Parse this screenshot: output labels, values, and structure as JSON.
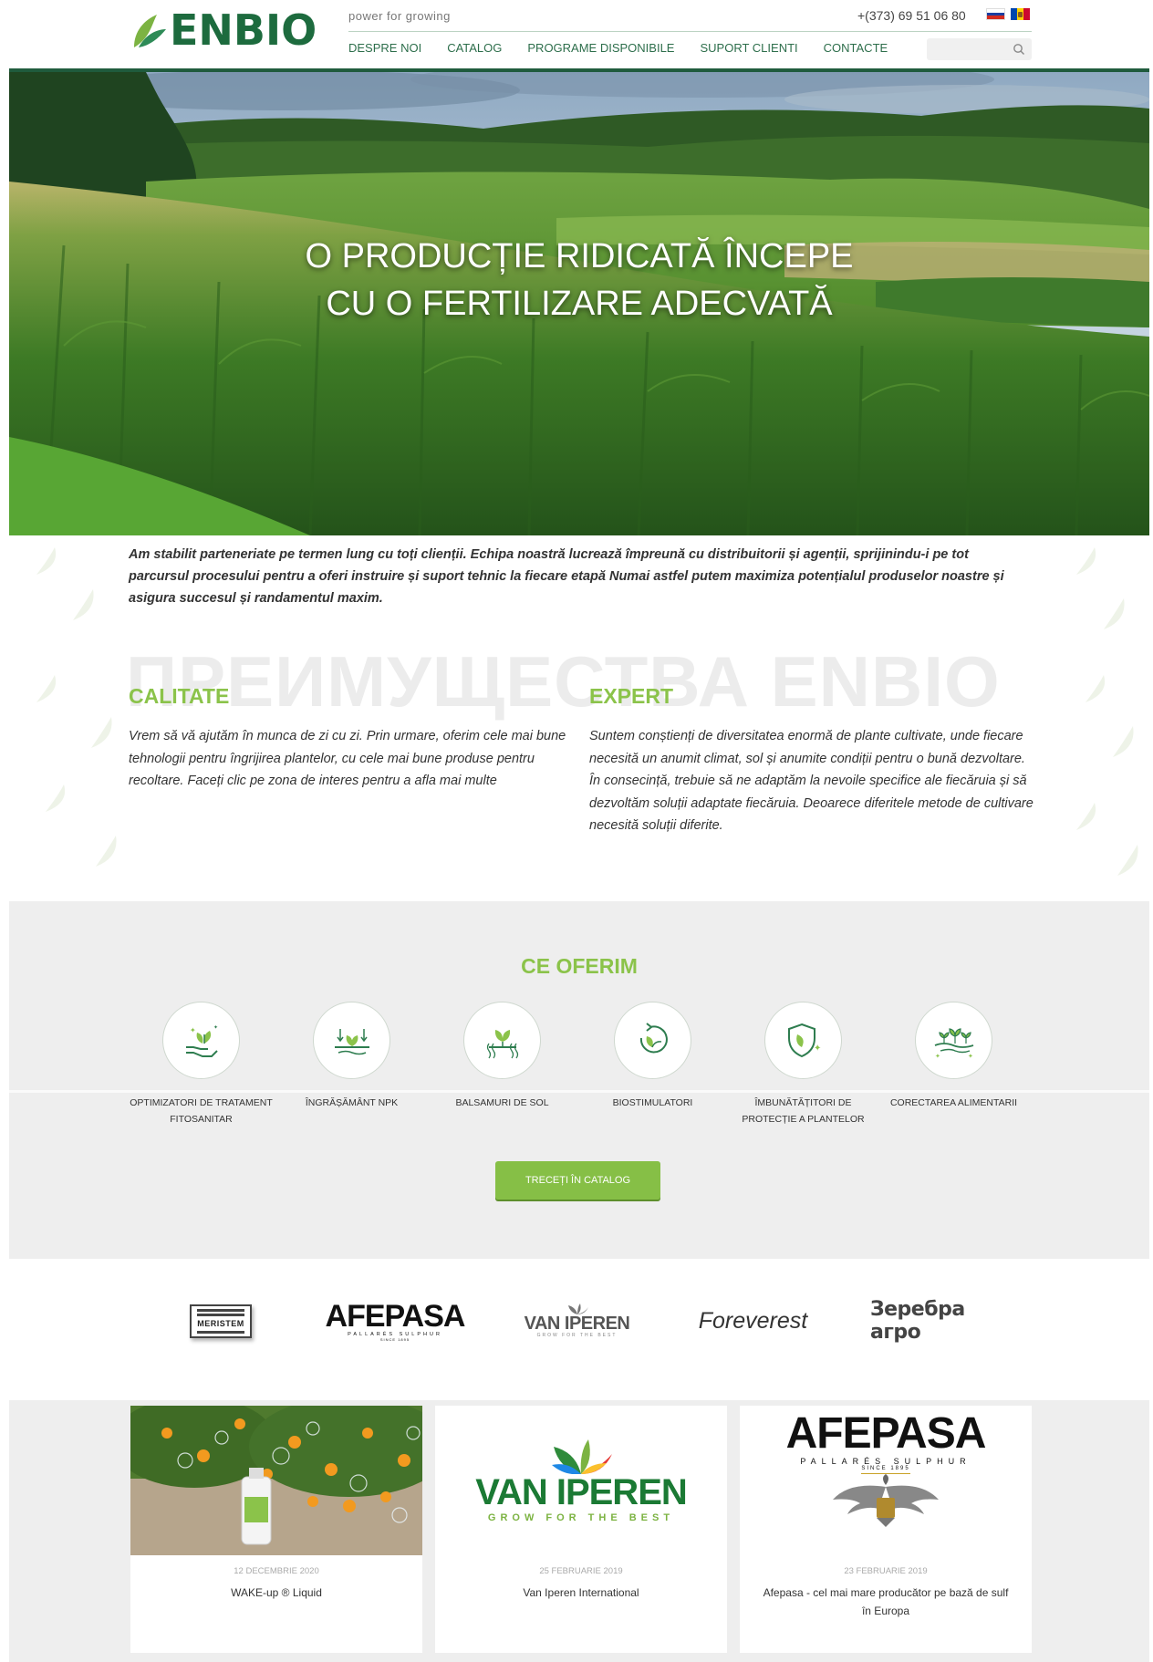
{
  "header": {
    "logo_text": "ENBIO",
    "tagline": "power for growing",
    "phone": "+(373) 69 51 06 80",
    "languages": [
      "ru-flag-icon",
      "md-flag-icon"
    ],
    "nav": [
      "DESPRE NOI",
      "CATALOG",
      "PROGRAME DISPONIBILE",
      "SUPORT CLIENTI",
      "CONTACTE"
    ],
    "search_placeholder": ""
  },
  "hero": {
    "title_line1": "O PRODUCȚIE RIDICATĂ ÎNCEPE",
    "title_line2": "CU O FERTILIZARE ADECVATĂ"
  },
  "intro": {
    "text": "Am stabilit parteneriate pe termen lung cu toți clienții. Echipa noastră lucrează împreună cu distribuitorii și agenții, sprijinindu-i pe tot parcursul procesului pentru a oferi instruire și suport tehnic la fiecare etapă Numai astfel putem maximiza potențialul produselor noastre și asigura succesul și randamentul maxim.",
    "watermark": "ПРЕИМУЩЕСТВА ENBIO"
  },
  "advantages": [
    {
      "title": "CALITATE",
      "text": "Vrem să vă ajutăm în munca de zi cu zi. Prin urmare, oferim cele mai bune tehnologii pentru îngrijirea plantelor, cu cele mai bune produse pentru recoltare. Faceți clic pe zona de interes pentru a afla mai multe"
    },
    {
      "title": "EXPERT",
      "text": "Suntem conștienți de diversitatea enormă de plante cultivate, unde fiecare necesită un anumit climat, sol și anumite condiții pentru o bună dezvoltare. În consecință, trebuie să ne adaptăm la nevoile specifice ale fiecăruia și să dezvoltăm soluții adaptate fiecăruia. Deoarece diferitele metode de cultivare necesită soluții diferite."
    }
  ],
  "offer": {
    "title": "CE OFERIM",
    "items": [
      {
        "label": "OPTIMIZATORI DE TRATAMENT FITOSANITAR",
        "icon": "hand-plant-icon"
      },
      {
        "label": "ÎNGRĂȘĂMÂNT NPK",
        "icon": "soil-nutrients-icon"
      },
      {
        "label": "BALSAMURI DE SOL",
        "icon": "soil-balm-icon"
      },
      {
        "label": "BIOSTIMULATORI",
        "icon": "biostimulator-icon"
      },
      {
        "label": "ÎMBUNĂTĂȚITORI DE PROTECȚIE A PLANTELOR",
        "icon": "shield-leaf-icon"
      },
      {
        "label": "CORECTAREA ALIMENTARII",
        "icon": "sprouts-icon"
      }
    ],
    "button": "TRECEȚI ÎN CATALOG"
  },
  "partners": [
    {
      "name": "MERISTEM"
    },
    {
      "name": "AFEPASA",
      "sub": "PALLARÉS SULPHUR",
      "since": "SINCE 1895"
    },
    {
      "name": "VAN IPEREN",
      "sub": "GROW FOR THE BEST"
    },
    {
      "name": "Foreverest"
    },
    {
      "name": "Зеребра агро"
    }
  ],
  "news": [
    {
      "date": "12 DECEMBRIE 2020",
      "title": "WAKE-up ® Liquid"
    },
    {
      "date": "25 FEBRUARIE 2019",
      "title": "Van Iperen International",
      "logo_name": "VAN IPEREN",
      "logo_sub": "GROW FOR THE BEST"
    },
    {
      "date": "23 FEBRUARIE 2019",
      "title": "Afepasa - cel mai mare producător pe bază de sulf în Europa",
      "logo_name": "AFEPASA",
      "logo_sub": "PALLARÉS SULPHUR",
      "logo_since": "SINCE 1895"
    }
  ],
  "colors": {
    "brand_green": "#1d6b3e",
    "accent_green": "#8bc34a",
    "nav_text": "#2d6e4b",
    "section_gray": "#eeeeee"
  }
}
